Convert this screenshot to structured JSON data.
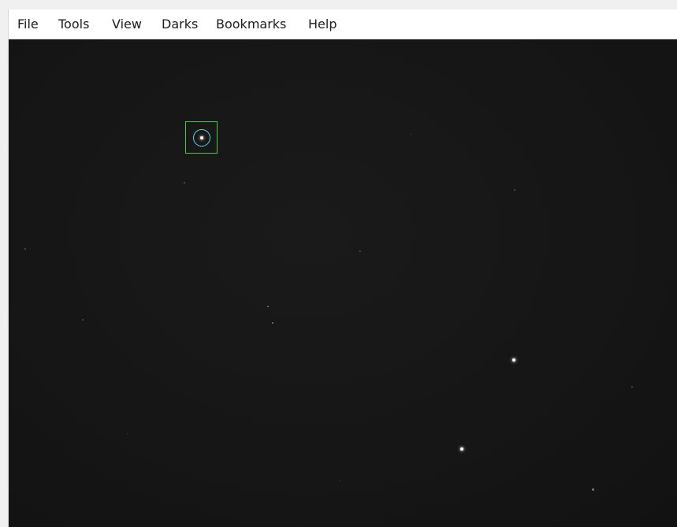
{
  "menu": {
    "items": [
      {
        "label": "File"
      },
      {
        "label": "Tools"
      },
      {
        "label": "View"
      },
      {
        "label": "Darks"
      },
      {
        "label": "Bookmarks"
      },
      {
        "label": "Help"
      }
    ]
  },
  "viewer": {
    "background_color": "#161616",
    "guide_box_color": "#3ecf3e",
    "guide_circle_color": "#5fd6e0"
  }
}
